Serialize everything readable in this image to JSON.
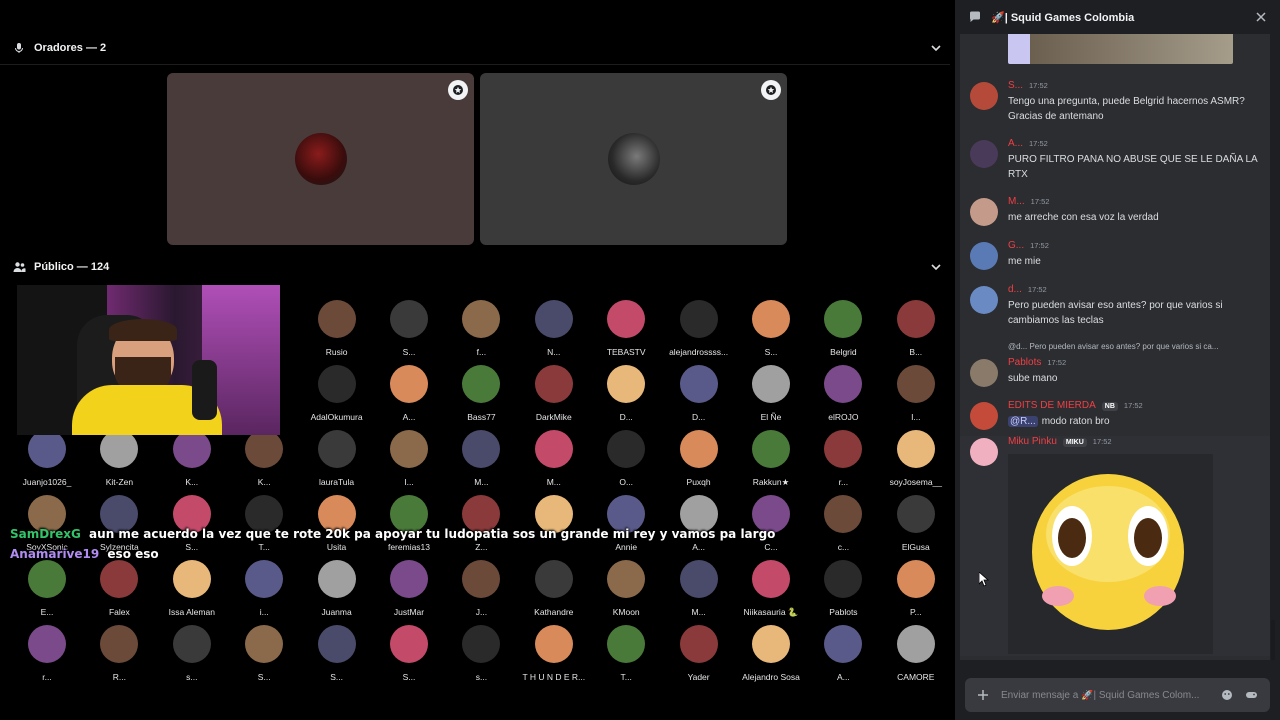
{
  "speakers": {
    "header": "Oradores — 2"
  },
  "audience": {
    "header": "Público — 124"
  },
  "overlay": {
    "line1_user": "SamDrexG",
    "line1_text": "aun me acuerdo la vez que te rote 20k pa apoyar tu ludopatia sos un grande mi rey y vamos pa largo",
    "line2_user": "Anamarive19",
    "line2_text": "eso eso"
  },
  "audience_rows": [
    [
      "Rusio",
      "S...",
      "f...",
      "N...",
      "TEBASTV",
      "alejandrossss...",
      "S...",
      "Belgrid",
      "B..."
    ],
    [
      "AdalOkumura",
      "A...",
      "Bass77",
      "DarkMike",
      "D...",
      "D...",
      "El Ñe",
      "elROJO",
      "I..."
    ],
    [
      "Juanjo1026_",
      "Kit-Zen",
      "K...",
      "K...",
      "lauraTula",
      "I...",
      "M...",
      "M...",
      "O...",
      "Puxqh",
      "Rakkun★",
      "r...",
      "soyJosema__"
    ],
    [
      "SoyXSonic",
      "Sylzencita",
      "S...",
      "T...",
      "Usita",
      "feremias13",
      "Z...",
      "",
      "Annie",
      "A...",
      "C...",
      "c...",
      "ElGusa"
    ],
    [
      "E...",
      "Falex",
      "Issa Aleman",
      "i...",
      "Juanma",
      "JustMar",
      "J...",
      "Kathandre",
      "KMoon",
      "M...",
      "Niikasauria 🐍",
      "Pablots",
      "P..."
    ],
    [
      "r...",
      "R...",
      "s...",
      "S...",
      "S...",
      "S...",
      "s...",
      "T H U N D E R...",
      "T...",
      "Yader",
      "Alejandro Sosa",
      "A...",
      "CAMORE"
    ]
  ],
  "chat": {
    "channel": "🚀| Squid Games Colombia",
    "messages": [
      {
        "user": "S...",
        "time": "17:52",
        "color": "#f23f43",
        "text": "Tengo una pregunta, puede Belgrid hacernos ASMR? Gracias de antemano"
      },
      {
        "user": "A...",
        "time": "17:52",
        "color": "#f23f43",
        "text": "PURO FILTRO PANA NO ABUSE QUE SE LE DAÑA LA RTX"
      },
      {
        "user": "M...",
        "time": "17:52",
        "color": "#f23f43",
        "text": "me arreche con esa voz la verdad"
      },
      {
        "user": "G...",
        "time": "17:52",
        "color": "#f23f43",
        "text": "me mie"
      },
      {
        "user": "d...",
        "time": "17:52",
        "color": "#f23f43",
        "text": "Pero pueden avisar eso antes? por que varios si cambiamos las teclas"
      },
      {
        "user": "Pablots",
        "time": "17:52",
        "color": "#f23f43",
        "reply": "@d... Pero pueden avisar eso antes? por que varios si ca...",
        "text": "sube mano"
      },
      {
        "user": "EDITS DE MIERDA",
        "tag": "NB",
        "time": "17:52",
        "color": "#f23f43",
        "mention": "@R...",
        "text": "modo raton bro"
      },
      {
        "user": "Miku Pinku",
        "tag": "MIKU",
        "time": "17:52",
        "color": "#f23f43",
        "text": ""
      }
    ],
    "input_placeholder": "Enviar mensaje a 🚀| Squid Games Colom..."
  }
}
